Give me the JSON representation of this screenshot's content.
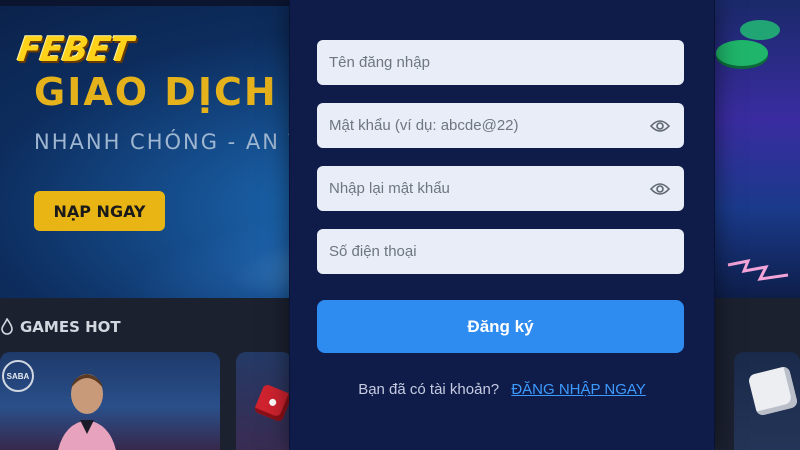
{
  "background": {
    "logo": "FEBET",
    "headline": "GIAO DỊCH BẢ",
    "subline": "NHANH CHÓNG - AN TOÀN -",
    "deposit_button": "NẠP NGAY",
    "section_title": "GAMES HOT",
    "provider_badge": "SABA"
  },
  "register_form": {
    "username_placeholder": "Tên đăng nhập",
    "password_placeholder": "Mật khẩu (ví dụ: abcde@22)",
    "confirm_password_placeholder": "Nhập lại mật khẩu",
    "phone_placeholder": "Số điện thoại",
    "submit_label": "Đăng ký",
    "have_account_text": "Bạn đã có tài khoản?",
    "login_link": "ĐĂNG NHẬP NGAY"
  },
  "colors": {
    "modal_bg": "#0f1c4a",
    "primary_button": "#2e8bf0",
    "link": "#3d9bff",
    "gold": "#e8b514"
  },
  "icons": [
    "eye-icon",
    "flame-icon",
    "dice-icon"
  ]
}
